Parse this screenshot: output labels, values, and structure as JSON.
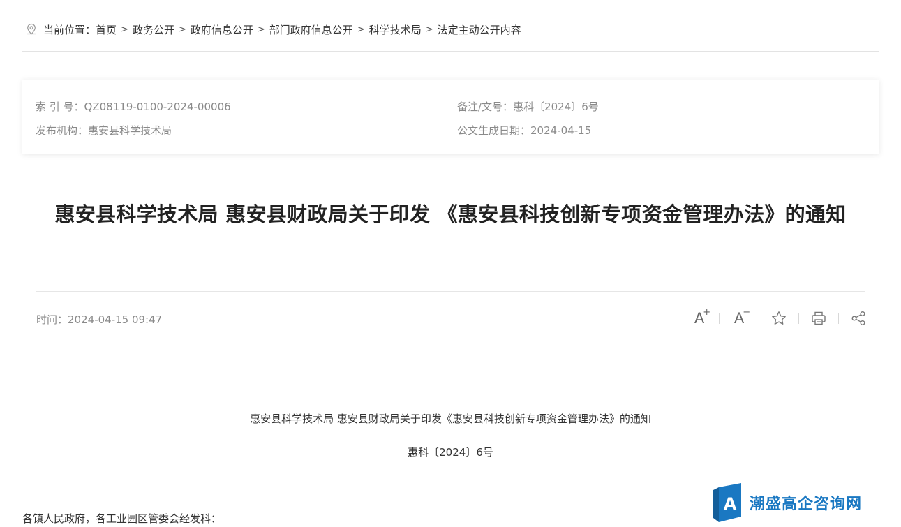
{
  "breadcrumb": {
    "icon": "location-pin-icon",
    "prefix": "当前位置：",
    "items": [
      "首页",
      "政务公开",
      "政府信息公开",
      "部门政府信息公开",
      "科学技术局",
      "法定主动公开内容"
    ],
    "separator": ">"
  },
  "meta": {
    "index_label": "索 引 号：",
    "index_value": "QZ08119-0100-2024-00006",
    "publisher_label": "发布机构：",
    "publisher_value": "惠安县科学技术局",
    "docno_label": "备注/文号：",
    "docno_value": "惠科〔2024〕6号",
    "date_label": "公文生成日期：",
    "date_value": "2024-04-15"
  },
  "article": {
    "title": "惠安县科学技术局 惠安县财政局关于印发 《惠安县科技创新专项资金管理办法》的通知",
    "time_label": "时间：",
    "time_value": "2024-04-15 09:47",
    "body_title": "惠安县科学技术局 惠安县财政局关于印发《惠安县科技创新专项资金管理办法》的通知",
    "doc_number": "惠科〔2024〕6号",
    "salutation": "各镇人民政府，各工业园区管委会经发科："
  },
  "tools": {
    "font_increase": "A",
    "font_increase_sup": "+",
    "font_decrease": "A",
    "font_decrease_sup": "−",
    "icons": [
      "font-increase-icon",
      "font-decrease-icon",
      "star-icon",
      "print-icon",
      "share-icon"
    ]
  },
  "watermark": {
    "text": "潮盛高企咨询网",
    "logo_letter": "A",
    "color": "#1a78c2"
  },
  "colors": {
    "muted_text": "#8a8a8a",
    "body_text": "#333333",
    "accent": "#1a78c2"
  }
}
